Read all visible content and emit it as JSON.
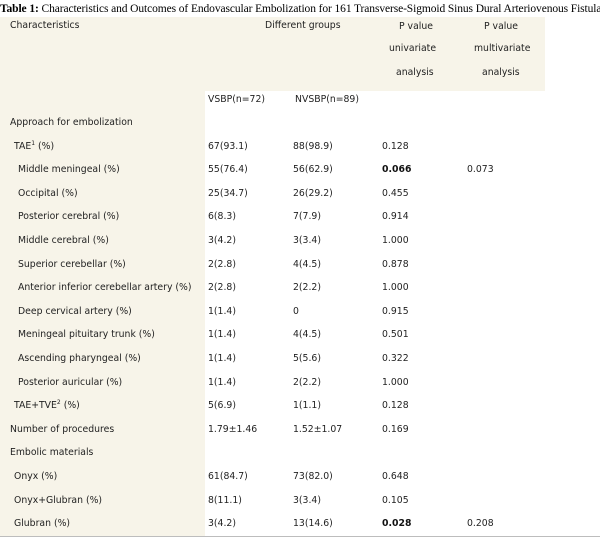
{
  "caption": {
    "label": "Table 1:",
    "text": " Characteristics and Outcomes of Endovascular Embolization for 161 Transverse-Sigmoid Sinus Dural Arteriovenous Fistulas."
  },
  "header": {
    "characteristics": "Characteristics",
    "groups": "Different groups",
    "p_uni": [
      "P value",
      "univariate",
      "analysis"
    ],
    "p_multi": [
      "P value",
      "multivariate",
      "analysis"
    ],
    "vsbp": "VSBP(n=72)",
    "nvsbp": "NVSBP(n=89)"
  },
  "rows": [
    {
      "label": "Approach for embolization",
      "section": true,
      "vsbp": "",
      "nvsbp": "",
      "p_uni": "",
      "p_multi": ""
    },
    {
      "label": "TAE",
      "sup": "1",
      "suffix": " (%)",
      "indent": 1,
      "vsbp": "67(93.1)",
      "nvsbp": "88(98.9)",
      "p_uni": "0.128",
      "p_multi": ""
    },
    {
      "label": "Middle meningeal (%)",
      "indent": 2,
      "vsbp": "55(76.4)",
      "nvsbp": "56(62.9)",
      "p_uni": "0.066",
      "p_uni_bold": true,
      "p_multi": "0.073"
    },
    {
      "label": "Occipital (%)",
      "indent": 2,
      "vsbp": "25(34.7)",
      "nvsbp": "26(29.2)",
      "p_uni": "0.455",
      "p_multi": ""
    },
    {
      "label": "Posterior cerebral (%)",
      "indent": 2,
      "vsbp": "6(8.3)",
      "nvsbp": "7(7.9)",
      "p_uni": "0.914",
      "p_multi": ""
    },
    {
      "label": "Middle cerebral (%)",
      "indent": 2,
      "vsbp": "3(4.2)",
      "nvsbp": "3(3.4)",
      "p_uni": "1.000",
      "p_multi": ""
    },
    {
      "label": "Superior cerebellar (%)",
      "indent": 2,
      "vsbp": "2(2.8)",
      "nvsbp": "4(4.5)",
      "p_uni": "0.878",
      "p_multi": ""
    },
    {
      "label": "Anterior inferior cerebellar artery (%)",
      "indent": 2,
      "vsbp": "2(2.8)",
      "nvsbp": "2(2.2)",
      "p_uni": "1.000",
      "p_multi": ""
    },
    {
      "label": "Deep cervical artery (%)",
      "indent": 2,
      "vsbp": "1(1.4)",
      "nvsbp": "0",
      "p_uni": "0.915",
      "p_multi": ""
    },
    {
      "label": "Meningeal pituitary trunk (%)",
      "indent": 2,
      "vsbp": "1(1.4)",
      "nvsbp": "4(4.5)",
      "p_uni": "0.501",
      "p_multi": ""
    },
    {
      "label": "Ascending pharyngeal (%)",
      "indent": 2,
      "vsbp": "1(1.4)",
      "nvsbp": "5(5.6)",
      "p_uni": "0.322",
      "p_multi": ""
    },
    {
      "label": "Posterior auricular (%)",
      "indent": 2,
      "vsbp": "1(1.4)",
      "nvsbp": "2(2.2)",
      "p_uni": "1.000",
      "p_multi": ""
    },
    {
      "label": "TAE+TVE",
      "sup": "2",
      "suffix": " (%)",
      "indent": 1,
      "vsbp": "5(6.9)",
      "nvsbp": "1(1.1)",
      "p_uni": "0.128",
      "p_multi": ""
    },
    {
      "label": "Number of procedures",
      "indent": 0,
      "vsbp": "1.79±1.46",
      "nvsbp": "1.52±1.07",
      "p_uni": "0.169",
      "p_multi": ""
    },
    {
      "label": "Embolic materials",
      "section": true,
      "vsbp": "",
      "nvsbp": "",
      "p_uni": "",
      "p_multi": ""
    },
    {
      "label": "Onyx (%)",
      "indent": 1,
      "vsbp": "61(84.7)",
      "nvsbp": "73(82.0)",
      "p_uni": "0.648",
      "p_multi": ""
    },
    {
      "label": "Onyx+Glubran (%)",
      "indent": 1,
      "vsbp": "8(11.1)",
      "nvsbp": "3(3.4)",
      "p_uni": "0.105",
      "p_multi": ""
    },
    {
      "label": "Glubran (%)",
      "indent": 1,
      "vsbp": "3(4.2)",
      "nvsbp": "13(14.6)",
      "p_uni": "0.028",
      "p_uni_bold": true,
      "p_multi": "0.208"
    }
  ]
}
